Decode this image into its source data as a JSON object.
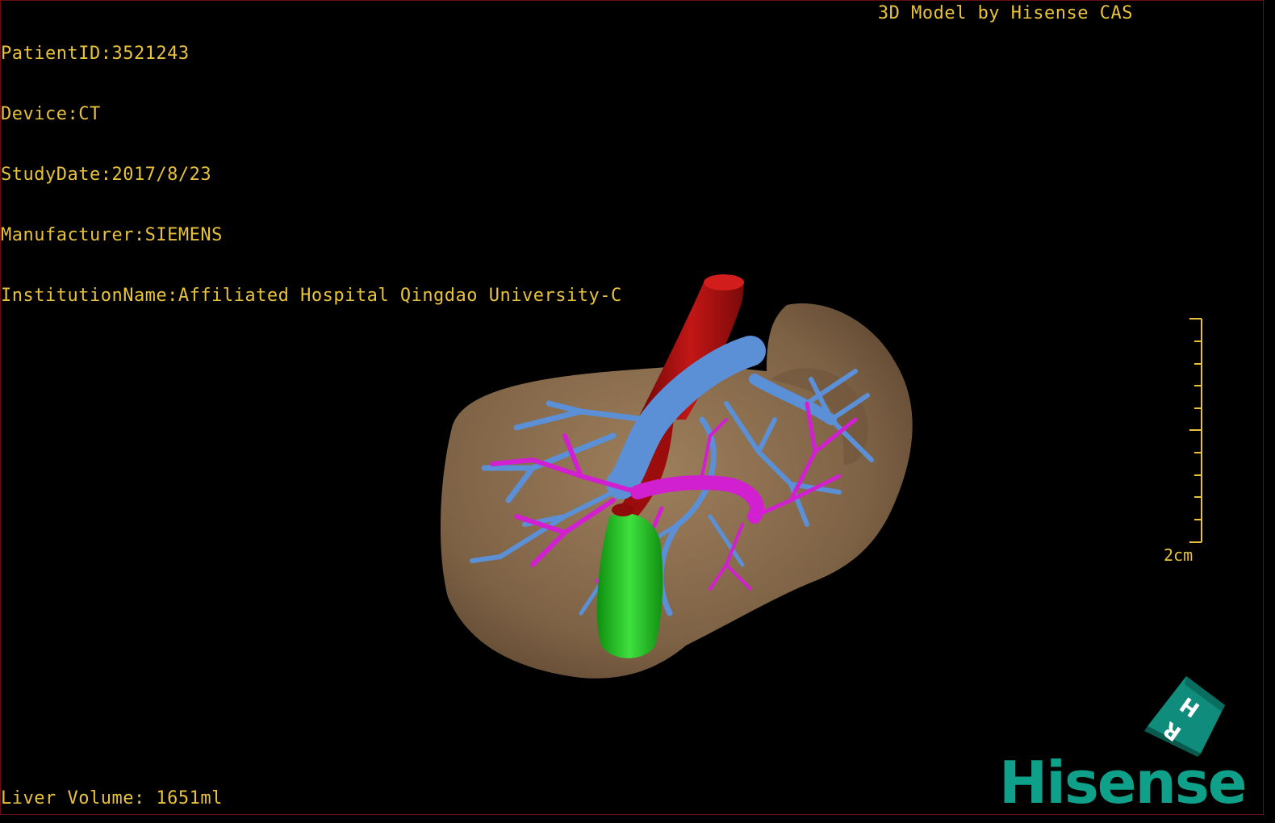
{
  "header": {
    "patient_id": "PatientID:3521243",
    "device": "Device:CT",
    "study_date": "StudyDate:2017/8/23",
    "manufacturer": "Manufacturer:SIEMENS",
    "institution": "InstitutionName:Affiliated Hospital Qingdao University-C"
  },
  "brand_caption": "3D Model by Hisense CAS",
  "scale_bar": {
    "label": "2cm"
  },
  "footer": {
    "liver_volume": "Liver Volume: 1651ml"
  },
  "orientation_cube": {
    "letters": [
      "H",
      "R"
    ]
  },
  "logo": {
    "text": "Hisense"
  },
  "colors": {
    "text": "#e8c23a",
    "liver": "#8b6e4e",
    "aorta": "#b01010",
    "portal_vein": "#5b8fd6",
    "hepatic_vessels": "#d020d0",
    "gallbladder": "#1fbf1f",
    "brand": "#0fa08a"
  }
}
